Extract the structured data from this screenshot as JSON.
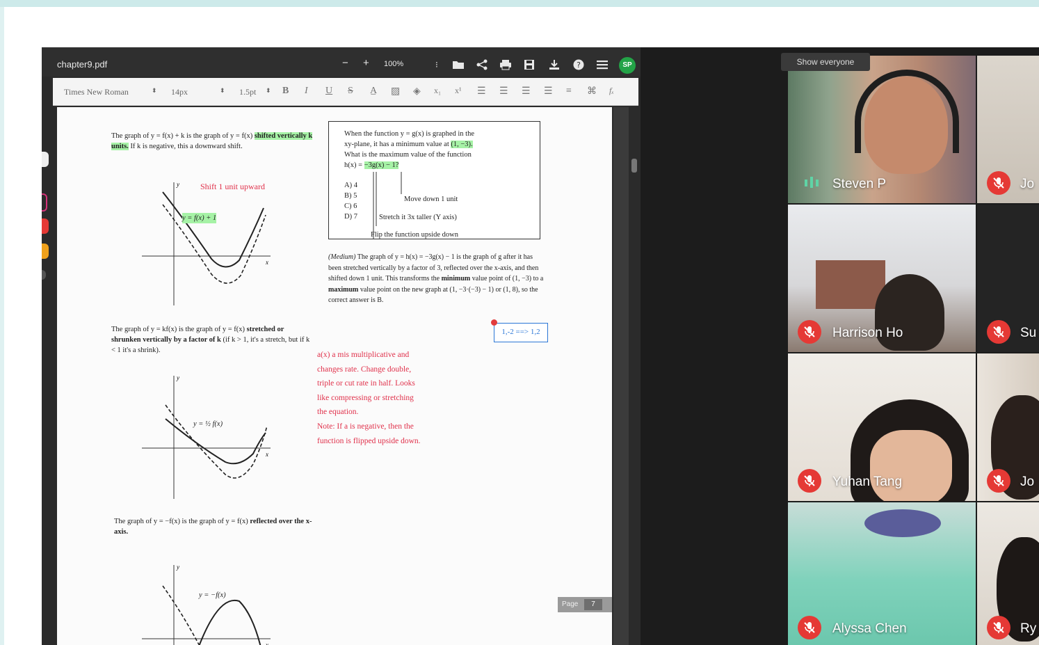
{
  "viewer": {
    "file_name": "chapter9.pdf",
    "zoom_out": "−",
    "zoom_in": "+",
    "zoom": "100%",
    "user_initials": "SP",
    "format": {
      "font": "Times New Roman",
      "size": "14px",
      "spacing": "1.5pt",
      "bold": "B",
      "italic": "I",
      "underline": "U",
      "strike": "S",
      "subscript": "x₁",
      "superscript": "x¹",
      "formula": "fₓ"
    },
    "page_label": "Page",
    "page_number": "7"
  },
  "document": {
    "shift_text_pre": "The graph of y = f(x) + k is the graph of y = f(x)",
    "shift_text_hl": "shifted vertically k units.",
    "shift_text_post": "If k is negative, this a downward shift.",
    "shift_note": "Shift 1 unit upward",
    "graph1_label": "y = f(x) + 1",
    "stretch_text_pre": "The graph of y = kf(x) is the graph of y = f(x)",
    "stretch_text_bold": "stretched or shrunken vertically by a factor of k",
    "stretch_text_post": "(if k > 1, it's a stretch, but if k < 1 it's a shrink).",
    "graph2_label": "y = ½ f(x)",
    "reflect_text_pre": "The graph of y = −f(x) is the graph of y = f(x)",
    "reflect_text_bold": "reflected over the x-axis.",
    "graph3_label": "y = −f(x)",
    "question": {
      "line1": "When the function y = g(x) is graphed in the",
      "line2_pre": "xy-plane, it has a minimum value at",
      "line2_hl": "(1, −3).",
      "line3": "What is the maximum value of the function",
      "line4_pre": "h(x) =",
      "line4_hl": "−3g(x) − 1?",
      "choices": [
        "A) 4",
        "B) 5",
        "C) 6",
        "D) 7"
      ],
      "note_move": "Move down 1 unit",
      "note_stretch": "Stretch it 3x taller (Y axis)",
      "note_flip": "Flip the function upside down"
    },
    "explanation_lead": "(Medium)",
    "explanation_1": " The graph of y = h(x) = −3g(x) − 1 is the graph of g after it has been stretched vertically by a factor of 3, reflected over the x-axis, and then shifted down 1 unit. This transforms the ",
    "explanation_min": "minimum",
    "explanation_2": " value point of (1, −3) to a ",
    "explanation_max": "maximum",
    "explanation_3": " value point on the new graph at (1, −3·(−3) − 1) or (1, 8), so the correct answer is B.",
    "answer_box": "1,-2 ==> 1,2",
    "red_note": [
      "a(x) a mis multiplicative and",
      "changes rate. Change double,",
      "triple or cut rate in half. Looks",
      "like compressing or stretching",
      "the equation.",
      "Note: If a is negative, then the",
      "function is flipped upside down."
    ]
  },
  "meeting": {
    "show_everyone": "Show everyone",
    "participants": [
      {
        "name": "Steven P",
        "muted": false
      },
      {
        "name": "Jo",
        "muted": true
      },
      {
        "name": "Harrison Ho",
        "muted": true
      },
      {
        "name": "Su",
        "muted": true
      },
      {
        "name": "Yuhan Tang",
        "muted": true
      },
      {
        "name": "Jo",
        "muted": true
      },
      {
        "name": "Alyssa Chen",
        "muted": true
      },
      {
        "name": "Ry",
        "muted": true
      }
    ]
  },
  "colors": {
    "highlight": "#a6f2a6",
    "annotation_red": "#e0304a",
    "annotation_blue": "#2a76d6",
    "mute_red": "#e53935",
    "avatar_green": "#23a347"
  }
}
